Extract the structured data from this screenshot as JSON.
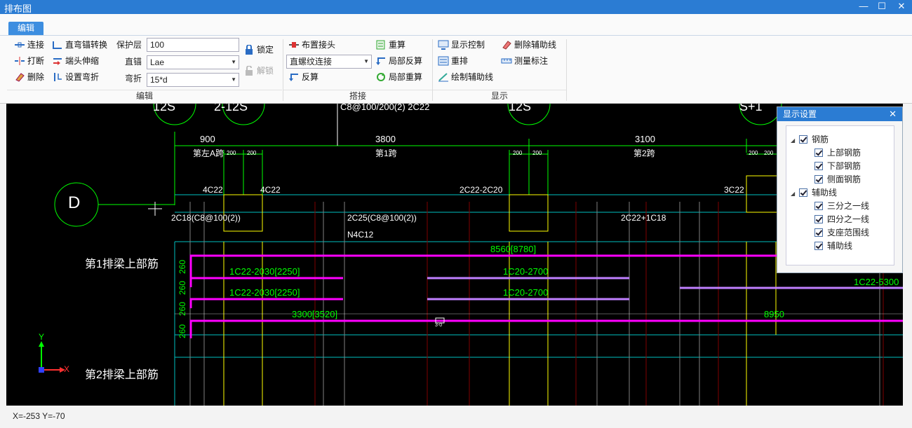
{
  "window": {
    "title": "排布图",
    "min": "—",
    "max": "☐",
    "close": "✕"
  },
  "tabs": [
    {
      "label": "编辑"
    }
  ],
  "ribbon": {
    "edit": {
      "connect": "连接",
      "break": "打断",
      "delete": "删除",
      "straight_bend_convert": "直弯锚转换",
      "end_stretch": "端头伸缩",
      "set_bend": "设置弯折",
      "cover_label": "保护层",
      "cover_value": "100",
      "straight_anchor_label": "直锚",
      "straight_anchor_value": "Lae",
      "bend_label": "弯折",
      "bend_value": "15*d",
      "lock": "锁定",
      "unlock": "解锁",
      "group": "编辑"
    },
    "splice": {
      "place_joint": "布置接头",
      "joint_type": "直螺纹连接",
      "reverse_calc": "反算",
      "recalc": "重算",
      "local_reverse": "局部反算",
      "local_recalc": "局部重算",
      "group": "搭接"
    },
    "display": {
      "display_control": "显示控制",
      "rearrange": "重排",
      "draw_aux": "绘制辅助线",
      "delete_aux": "删除辅助线",
      "measure": "测量标注",
      "group": "显示"
    }
  },
  "canvas": {
    "axis_label": "D",
    "top_texts": [
      "12S",
      "2-12S",
      "C8@100/200(2) 2C22",
      "12S",
      "S+1"
    ],
    "spans": [
      {
        "dim": "900",
        "name": "第左A跨"
      },
      {
        "dim": "3800",
        "name": "第1跨"
      },
      {
        "dim": "3100",
        "name": "第2跨"
      }
    ],
    "small_dims": [
      "200",
      "200",
      "200",
      "200",
      "200",
      "200"
    ],
    "beam_labels": [
      "4C22",
      "4C22",
      "2C22-2C20",
      "3C22"
    ],
    "section_labels": [
      "2C18(C8@100(2))",
      "2C25(C8@100(2))",
      "2C22+1C18",
      "N4C12"
    ],
    "row1_title": "第1排梁上部筋",
    "row2_title": "第2排梁上部筋",
    "vertical_dims": [
      "260",
      "260",
      "260",
      "260"
    ],
    "bar_labels": [
      "8560[8780]",
      "1C22-2030[2250]",
      "1C20-2700",
      "1C22-2030[2250]",
      "1C20-2700",
      "3300[3520]",
      "8950",
      "1C22-5300"
    ],
    "joint_mark": "3-0",
    "axis_x": "X",
    "axis_y": "Y"
  },
  "panel": {
    "title": "显示设置",
    "close": "✕",
    "rebar": {
      "label": "钢筋",
      "children": [
        "上部钢筋",
        "下部钢筋",
        "侧面钢筋"
      ]
    },
    "aux": {
      "label": "辅助线",
      "children": [
        "三分之一线",
        "四分之一线",
        "支座范围线",
        "辅助线"
      ]
    }
  },
  "status": {
    "coords": "X=-253 Y=-70"
  },
  "colors": {
    "accent": "#2b7cd3",
    "magenta": "#ff00ff",
    "light_purple": "#c080ff",
    "green": "#00ff00",
    "yellow": "#ffff00",
    "cyan": "#00c0c0",
    "dark_red": "#800000"
  }
}
